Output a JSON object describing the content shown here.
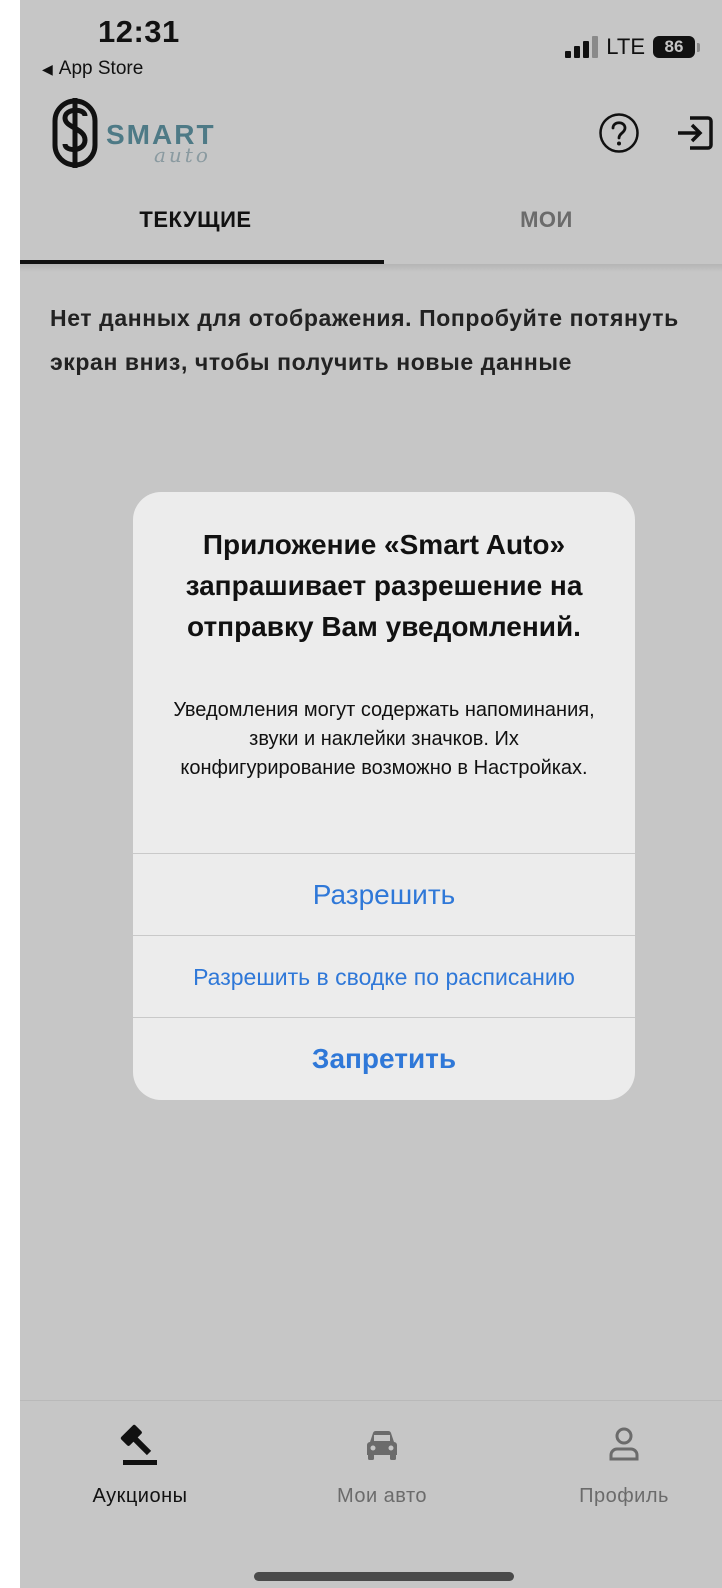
{
  "status_bar": {
    "time": "12:31",
    "back_label": "App Store",
    "network": "LTE",
    "battery": "86"
  },
  "header": {
    "logo_text": "SMART",
    "logo_subtext": "auto"
  },
  "tabs": [
    {
      "label": "ТЕКУЩИЕ",
      "active": true
    },
    {
      "label": "МОИ",
      "active": false
    }
  ],
  "empty_message": "Нет данных для отображения. Попробуйте потянуть экран вниз, чтобы получить новые данные",
  "dialog": {
    "title": "Приложение «Smart Auto» запрашивает разрешение на отправку Вам уведомлений.",
    "message": "Уведомления могут содержать напоминания, звуки и наклейки значков. Их конфигурирование возможно в Настройках.",
    "allow_label": "Разрешить",
    "summary_label": "Разрешить в сводке по расписанию",
    "deny_label": "Запретить"
  },
  "bottom_nav": [
    {
      "label": "Аукционы",
      "icon": "gavel-icon",
      "active": true
    },
    {
      "label": "Мои авто",
      "icon": "car-icon",
      "active": false
    },
    {
      "label": "Профиль",
      "icon": "person-icon",
      "active": false
    }
  ],
  "colors": {
    "background": "#c6c6c6",
    "accent_blue": "#2f78d8",
    "logo_teal": "#4e7a86"
  }
}
